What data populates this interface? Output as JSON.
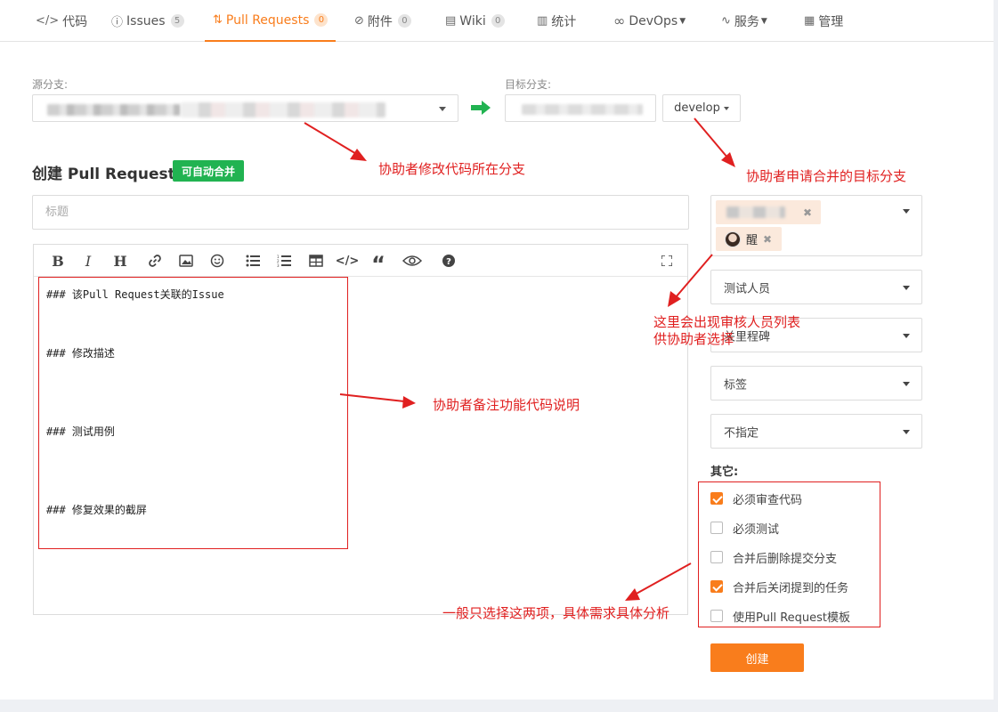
{
  "tabs": [
    {
      "label": "代码",
      "icon": "code-icon"
    },
    {
      "label": "Issues",
      "badge": "5",
      "icon": "issue-icon"
    },
    {
      "label": "Pull Requests",
      "badge": "0",
      "icon": "pull-request-icon",
      "active": true
    },
    {
      "label": "附件",
      "badge": "0",
      "icon": "paperclip-icon"
    },
    {
      "label": "Wiki",
      "badge": "0",
      "icon": "book-icon"
    },
    {
      "label": "统计",
      "icon": "bar-chart-icon"
    },
    {
      "label": "DevOps",
      "icon": "infinity-icon"
    },
    {
      "label": "服务",
      "icon": "pulse-icon"
    },
    {
      "label": "管理",
      "icon": "document-icon"
    }
  ],
  "form": {
    "source_label": "源分支:",
    "target_label": "目标分支:",
    "target_branch": "develop",
    "heading": "创建 Pull Request",
    "auto_merge_badge": "可自动合并",
    "title_placeholder": "标题",
    "editor_lines": {
      "l1": "### 该Pull Request关联的Issue",
      "l2": "### 修改描述",
      "l3": "### 测试用例",
      "l4": "### 修复效果的截屏"
    }
  },
  "sidebar": {
    "reviewer_chip_name": "醒",
    "testers_placeholder": "测试人员",
    "milestone_placeholder": "关里程碑",
    "labels_placeholder": "标签",
    "priority_placeholder": "不指定",
    "other_label": "其它:",
    "options": [
      {
        "label": "必须审查代码",
        "checked": true
      },
      {
        "label": "必须测试",
        "checked": false
      },
      {
        "label": "合并后删除提交分支",
        "checked": false
      },
      {
        "label": "合并后关闭提到的任务",
        "checked": true
      },
      {
        "label": "使用Pull Request模板",
        "checked": false
      }
    ],
    "create_button": "创建"
  },
  "annotations": {
    "source_note": "协助者修改代码所在分支",
    "target_note": "协助者申请合并的目标分支",
    "reviewer_note_1": "这里会出现审核人员列表",
    "reviewer_note_2": "供协助者选择",
    "editor_note": "协助者备注功能代码说明",
    "options_note": "一般只选择这两项，具体需求具体分析"
  },
  "colors": {
    "accent": "#f97d1c",
    "success": "#21b351",
    "annotation": "#e02020"
  }
}
